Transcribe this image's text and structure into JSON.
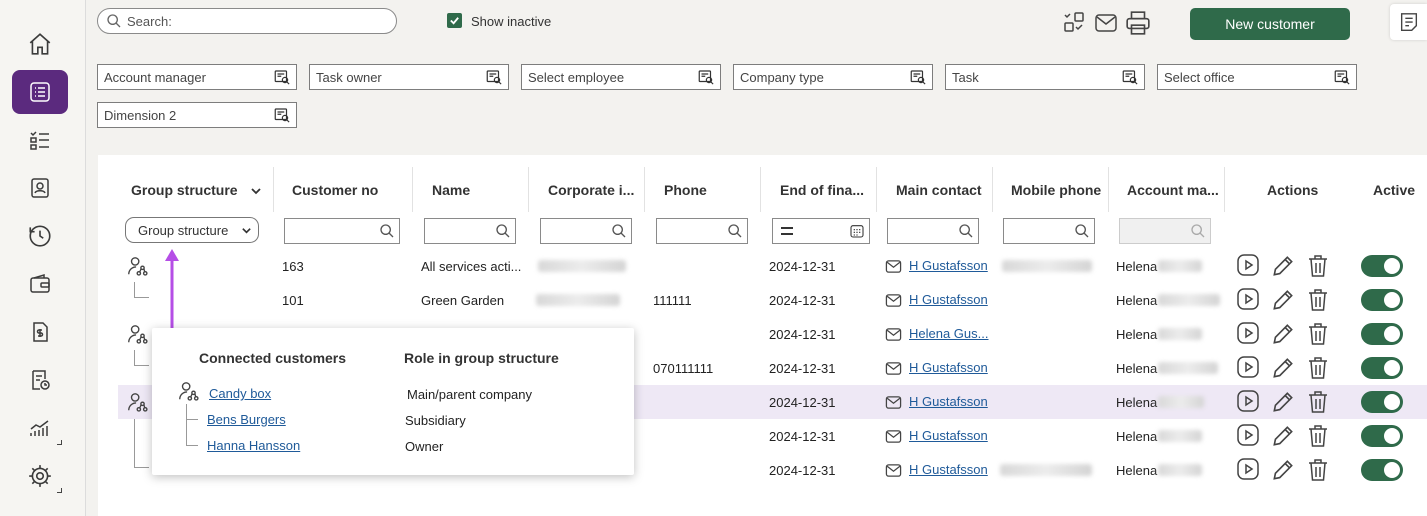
{
  "search": {
    "placeholder": "Search:"
  },
  "show_inactive": "Show inactive",
  "new_customer": "New customer",
  "filters": [
    "Account manager",
    "Task owner",
    "Select employee",
    "Company type",
    "Task",
    "Select office",
    "Dimension 2"
  ],
  "columns": {
    "group": "Group structure",
    "customer_no": "Customer no",
    "name": "Name",
    "corporate": "Corporate i...",
    "phone": "Phone",
    "end_fin": "End of fina...",
    "main_contact": "Main contact",
    "mobile": "Mobile phone",
    "account_manager": "Account ma...",
    "actions": "Actions",
    "active": "Active"
  },
  "group_select": "Group structure",
  "rows": [
    {
      "customer_no": "163",
      "name": "All services acti...",
      "phone": "",
      "date": "2024-12-31",
      "contact": "H Gustafsson",
      "manager": "Helena"
    },
    {
      "customer_no": "101",
      "name": "Green Garden",
      "phone": "111111",
      "date": "2024-12-31",
      "contact": "H Gustafsson",
      "manager": "Helena"
    },
    {
      "customer_no": "",
      "name": "",
      "phone": "",
      "date": "2024-12-31",
      "contact": "Helena Gus...",
      "manager": "Helena"
    },
    {
      "customer_no": "",
      "name": "",
      "phone": "070111111",
      "date": "2024-12-31",
      "contact": "H Gustafsson",
      "manager": "Helena"
    },
    {
      "customer_no": "",
      "name": "",
      "phone": "",
      "date": "2024-12-31",
      "contact": "H Gustafsson",
      "manager": "Helena"
    },
    {
      "customer_no": "",
      "name": "",
      "phone": "",
      "date": "2024-12-31",
      "contact": "H Gustafsson",
      "manager": "Helena"
    },
    {
      "customer_no": "",
      "name": "",
      "phone": "",
      "date": "2024-12-31",
      "contact": "H Gustafsson",
      "manager": "Helena"
    }
  ],
  "popup": {
    "col1": "Connected customers",
    "col2": "Role in group structure",
    "items": [
      {
        "name": "Candy box",
        "role": "Main/parent company"
      },
      {
        "name": "Bens Burgers",
        "role": "Subsidiary"
      },
      {
        "name": "Hanna Hansson",
        "role": "Owner"
      }
    ]
  },
  "colors": {
    "brand": "#5b2a7e",
    "primary": "#2f6a4a",
    "highlight": "#eee8f5",
    "arrow": "#b54ee6"
  }
}
